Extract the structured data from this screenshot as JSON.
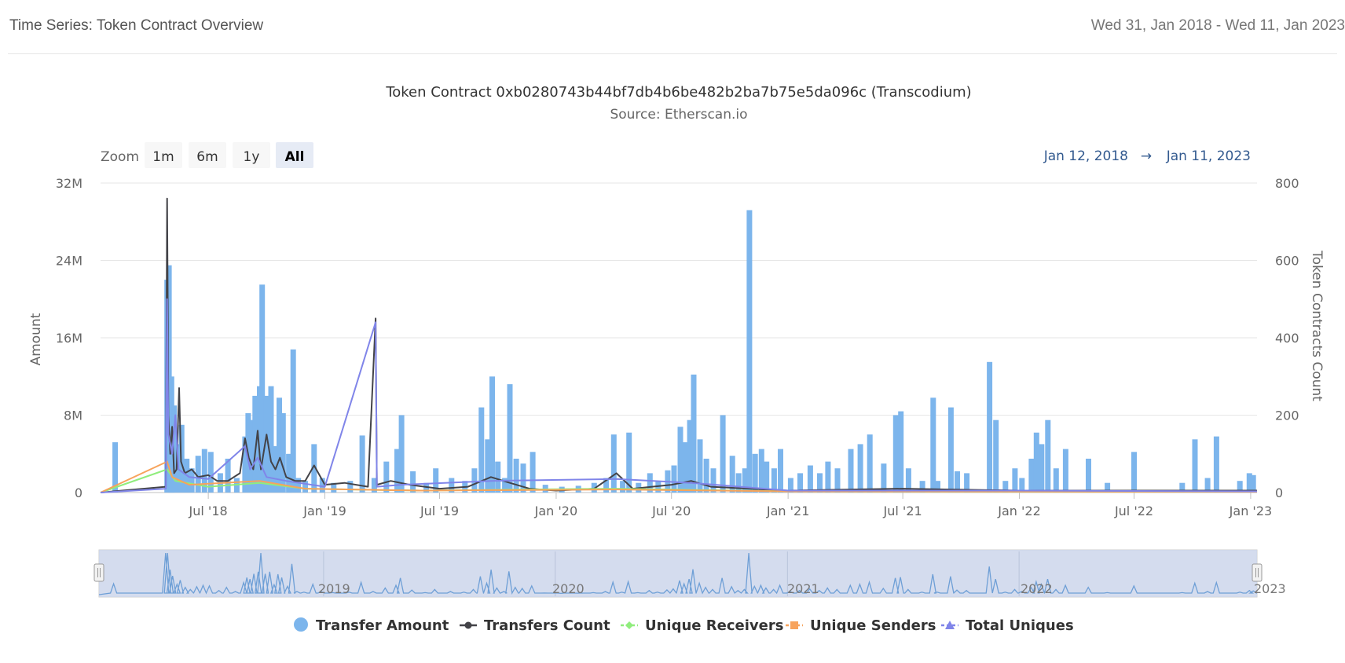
{
  "header": {
    "title": "Time Series: Token Contract Overview",
    "date_range": "Wed 31, Jan 2018 - Wed 11, Jan 2023"
  },
  "chart": {
    "title": "Token Contract 0xb0280743b44bf7db4b6be482b2ba7b75e5da096c (Transcodium)",
    "subtitle": "Source: Etherscan.io",
    "zoom": {
      "label": "Zoom",
      "buttons": [
        {
          "label": "1m",
          "active": false
        },
        {
          "label": "6m",
          "active": false
        },
        {
          "label": "1y",
          "active": false
        },
        {
          "label": "All",
          "active": true
        }
      ]
    },
    "range_from": "Jan 12, 2018",
    "range_arrow": "→",
    "range_to": "Jan 11, 2023",
    "navigator_years": [
      "2019",
      "2020",
      "2021",
      "2022",
      "2023"
    ]
  },
  "chart_data": {
    "type": "bar",
    "x_start": "2018-01-12",
    "x_end": "2023-01-11",
    "y_left": {
      "label": "Amount",
      "min": 0,
      "max": 32000000,
      "ticks": [
        "0",
        "8M",
        "16M",
        "24M",
        "32M"
      ]
    },
    "y_right": {
      "label": "Token Contracts Count",
      "min": 0,
      "max": 800,
      "ticks": [
        "0",
        "200",
        "400",
        "600",
        "800"
      ]
    },
    "x_ticks": [
      {
        "label": "Jul '18",
        "date": "2018-07-01"
      },
      {
        "label": "Jan '19",
        "date": "2019-01-01"
      },
      {
        "label": "Jul '19",
        "date": "2019-07-01"
      },
      {
        "label": "Jan '20",
        "date": "2020-01-01"
      },
      {
        "label": "Jul '20",
        "date": "2020-07-01"
      },
      {
        "label": "Jan '21",
        "date": "2021-01-01"
      },
      {
        "label": "Jul '21",
        "date": "2021-07-01"
      },
      {
        "label": "Jan '22",
        "date": "2022-01-01"
      },
      {
        "label": "Jul '22",
        "date": "2022-07-01"
      },
      {
        "label": "Jan '23",
        "date": "2023-01-01"
      }
    ],
    "grid": true,
    "legend_position": "bottom",
    "series": [
      {
        "name": "Transfer Amount",
        "type": "column",
        "axis": "left",
        "color": "#7cb5ec",
        "points": [
          [
            "2018-02-04",
            5200000
          ],
          [
            "2018-04-27",
            22000000
          ],
          [
            "2018-04-30",
            23500000
          ],
          [
            "2018-05-04",
            12000000
          ],
          [
            "2018-05-08",
            9000000
          ],
          [
            "2018-05-15",
            5000000
          ],
          [
            "2018-05-20",
            7000000
          ],
          [
            "2018-05-28",
            3500000
          ],
          [
            "2018-06-05",
            2500000
          ],
          [
            "2018-06-15",
            3800000
          ],
          [
            "2018-06-25",
            4500000
          ],
          [
            "2018-07-05",
            4200000
          ],
          [
            "2018-07-20",
            2000000
          ],
          [
            "2018-08-01",
            3500000
          ],
          [
            "2018-08-15",
            1500000
          ],
          [
            "2018-08-28",
            5800000
          ],
          [
            "2018-09-02",
            8200000
          ],
          [
            "2018-09-07",
            7500000
          ],
          [
            "2018-09-13",
            10000000
          ],
          [
            "2018-09-20",
            11000000
          ],
          [
            "2018-09-24",
            21500000
          ],
          [
            "2018-10-01",
            10000000
          ],
          [
            "2018-10-08",
            11000000
          ],
          [
            "2018-10-15",
            4800000
          ],
          [
            "2018-10-21",
            9800000
          ],
          [
            "2018-10-27",
            8200000
          ],
          [
            "2018-11-05",
            4000000
          ],
          [
            "2018-11-12",
            14800000
          ],
          [
            "2018-11-20",
            1500000
          ],
          [
            "2018-12-01",
            1200000
          ],
          [
            "2018-12-15",
            5000000
          ],
          [
            "2018-12-28",
            1500000
          ],
          [
            "2019-01-15",
            1000000
          ],
          [
            "2019-02-10",
            1200000
          ],
          [
            "2019-03-01",
            5900000
          ],
          [
            "2019-03-20",
            1500000
          ],
          [
            "2019-04-08",
            3200000
          ],
          [
            "2019-04-25",
            4500000
          ],
          [
            "2019-05-02",
            8000000
          ],
          [
            "2019-05-20",
            2200000
          ],
          [
            "2019-06-10",
            1000000
          ],
          [
            "2019-06-25",
            2500000
          ],
          [
            "2019-07-20",
            1500000
          ],
          [
            "2019-08-10",
            1200000
          ],
          [
            "2019-08-25",
            2500000
          ],
          [
            "2019-09-05",
            8800000
          ],
          [
            "2019-09-15",
            5500000
          ],
          [
            "2019-09-22",
            12000000
          ],
          [
            "2019-10-01",
            3200000
          ],
          [
            "2019-10-12",
            1500000
          ],
          [
            "2019-10-20",
            11200000
          ],
          [
            "2019-10-30",
            3500000
          ],
          [
            "2019-11-10",
            3000000
          ],
          [
            "2019-11-25",
            4200000
          ],
          [
            "2019-12-15",
            800000
          ],
          [
            "2020-01-10",
            600000
          ],
          [
            "2020-02-05",
            700000
          ],
          [
            "2020-03-01",
            1000000
          ],
          [
            "2020-03-20",
            1500000
          ],
          [
            "2020-04-01",
            6000000
          ],
          [
            "2020-04-15",
            1200000
          ],
          [
            "2020-04-25",
            6200000
          ],
          [
            "2020-05-10",
            1000000
          ],
          [
            "2020-05-28",
            2000000
          ],
          [
            "2020-06-10",
            1200000
          ],
          [
            "2020-06-25",
            2300000
          ],
          [
            "2020-07-05",
            2800000
          ],
          [
            "2020-07-15",
            6800000
          ],
          [
            "2020-07-22",
            5200000
          ],
          [
            "2020-07-30",
            7500000
          ],
          [
            "2020-08-05",
            12200000
          ],
          [
            "2020-08-15",
            5500000
          ],
          [
            "2020-08-25",
            3500000
          ],
          [
            "2020-09-05",
            2500000
          ],
          [
            "2020-09-20",
            8000000
          ],
          [
            "2020-10-05",
            3800000
          ],
          [
            "2020-10-15",
            2000000
          ],
          [
            "2020-10-25",
            2500000
          ],
          [
            "2020-11-01",
            29200000
          ],
          [
            "2020-11-10",
            4000000
          ],
          [
            "2020-11-20",
            4500000
          ],
          [
            "2020-11-28",
            3200000
          ],
          [
            "2020-12-10",
            2500000
          ],
          [
            "2020-12-20",
            4500000
          ],
          [
            "2021-01-05",
            1500000
          ],
          [
            "2021-01-20",
            2000000
          ],
          [
            "2021-02-05",
            2800000
          ],
          [
            "2021-02-20",
            2000000
          ],
          [
            "2021-03-05",
            3200000
          ],
          [
            "2021-03-20",
            2500000
          ],
          [
            "2021-04-10",
            4500000
          ],
          [
            "2021-04-25",
            5000000
          ],
          [
            "2021-05-10",
            6000000
          ],
          [
            "2021-06-01",
            3000000
          ],
          [
            "2021-06-20",
            8000000
          ],
          [
            "2021-06-28",
            8400000
          ],
          [
            "2021-07-10",
            2500000
          ],
          [
            "2021-08-01",
            1200000
          ],
          [
            "2021-08-18",
            9800000
          ],
          [
            "2021-08-25",
            1200000
          ],
          [
            "2021-09-15",
            8800000
          ],
          [
            "2021-09-25",
            2200000
          ],
          [
            "2021-10-10",
            2000000
          ],
          [
            "2021-11-15",
            13500000
          ],
          [
            "2021-11-25",
            7500000
          ],
          [
            "2021-12-10",
            1200000
          ],
          [
            "2021-12-25",
            2500000
          ],
          [
            "2022-01-05",
            1500000
          ],
          [
            "2022-01-20",
            3500000
          ],
          [
            "2022-01-28",
            6200000
          ],
          [
            "2022-02-05",
            5000000
          ],
          [
            "2022-02-15",
            7500000
          ],
          [
            "2022-02-28",
            2500000
          ],
          [
            "2022-03-15",
            4500000
          ],
          [
            "2022-04-20",
            3500000
          ],
          [
            "2022-05-20",
            1000000
          ],
          [
            "2022-07-01",
            4200000
          ],
          [
            "2022-09-15",
            1000000
          ],
          [
            "2022-10-05",
            5500000
          ],
          [
            "2022-10-25",
            1500000
          ],
          [
            "2022-11-08",
            5800000
          ],
          [
            "2022-12-15",
            1200000
          ],
          [
            "2022-12-30",
            2000000
          ],
          [
            "2023-01-05",
            1800000
          ]
        ]
      },
      {
        "name": "Transfers Count",
        "type": "line",
        "axis": "right",
        "color": "#434348",
        "points": [
          [
            "2018-01-12",
            0
          ],
          [
            "2018-02-15",
            5
          ],
          [
            "2018-04-25",
            15
          ],
          [
            "2018-04-27",
            760
          ],
          [
            "2018-04-28",
            500
          ],
          [
            "2018-04-29",
            200
          ],
          [
            "2018-05-02",
            100
          ],
          [
            "2018-05-05",
            170
          ],
          [
            "2018-05-08",
            50
          ],
          [
            "2018-05-12",
            60
          ],
          [
            "2018-05-16",
            270
          ],
          [
            "2018-05-19",
            80
          ],
          [
            "2018-05-25",
            50
          ],
          [
            "2018-06-05",
            60
          ],
          [
            "2018-06-15",
            40
          ],
          [
            "2018-07-01",
            45
          ],
          [
            "2018-07-15",
            30
          ],
          [
            "2018-08-01",
            30
          ],
          [
            "2018-08-20",
            50
          ],
          [
            "2018-08-28",
            140
          ],
          [
            "2018-09-03",
            90
          ],
          [
            "2018-09-10",
            60
          ],
          [
            "2018-09-17",
            160
          ],
          [
            "2018-09-22",
            60
          ],
          [
            "2018-10-01",
            150
          ],
          [
            "2018-10-08",
            80
          ],
          [
            "2018-10-15",
            60
          ],
          [
            "2018-10-22",
            90
          ],
          [
            "2018-11-01",
            40
          ],
          [
            "2018-11-15",
            30
          ],
          [
            "2018-12-01",
            30
          ],
          [
            "2018-12-15",
            70
          ],
          [
            "2019-01-01",
            20
          ],
          [
            "2019-02-01",
            25
          ],
          [
            "2019-03-10",
            15
          ],
          [
            "2019-03-22",
            450
          ],
          [
            "2019-03-24",
            20
          ],
          [
            "2019-04-15",
            30
          ],
          [
            "2019-05-15",
            20
          ],
          [
            "2019-07-01",
            10
          ],
          [
            "2019-08-15",
            15
          ],
          [
            "2019-09-20",
            40
          ],
          [
            "2019-10-20",
            25
          ],
          [
            "2019-11-20",
            10
          ],
          [
            "2020-01-01",
            5
          ],
          [
            "2020-03-01",
            10
          ],
          [
            "2020-04-05",
            50
          ],
          [
            "2020-05-01",
            10
          ],
          [
            "2020-07-01",
            20
          ],
          [
            "2020-08-01",
            30
          ],
          [
            "2020-09-01",
            15
          ],
          [
            "2020-11-01",
            10
          ],
          [
            "2021-01-01",
            5
          ],
          [
            "2021-07-01",
            10
          ],
          [
            "2022-01-01",
            5
          ],
          [
            "2022-07-01",
            5
          ],
          [
            "2023-01-11",
            5
          ]
        ]
      },
      {
        "name": "Unique Receivers",
        "type": "line",
        "axis": "right",
        "color": "#90ed7d",
        "points": [
          [
            "2018-01-12",
            0
          ],
          [
            "2018-04-27",
            60
          ],
          [
            "2018-05-10",
            30
          ],
          [
            "2018-07-01",
            15
          ],
          [
            "2018-09-20",
            25
          ],
          [
            "2018-12-01",
            10
          ],
          [
            "2019-06-01",
            5
          ],
          [
            "2020-04-05",
            10
          ],
          [
            "2021-01-01",
            3
          ],
          [
            "2023-01-11",
            2
          ]
        ]
      },
      {
        "name": "Unique Senders",
        "type": "line",
        "axis": "right",
        "color": "#f7a35c",
        "points": [
          [
            "2018-01-12",
            0
          ],
          [
            "2018-04-27",
            80
          ],
          [
            "2018-05-05",
            40
          ],
          [
            "2018-06-01",
            20
          ],
          [
            "2018-09-20",
            30
          ],
          [
            "2018-12-01",
            10
          ],
          [
            "2019-06-01",
            5
          ],
          [
            "2020-04-05",
            8
          ],
          [
            "2021-01-01",
            3
          ],
          [
            "2023-01-11",
            2
          ]
        ]
      },
      {
        "name": "Total Uniques",
        "type": "line",
        "axis": "right",
        "color": "#8085e9",
        "points": [
          [
            "2018-01-12",
            0
          ],
          [
            "2018-04-25",
            10
          ],
          [
            "2018-04-27",
            500
          ],
          [
            "2018-04-29",
            150
          ],
          [
            "2018-05-05",
            100
          ],
          [
            "2018-05-10",
            200
          ],
          [
            "2018-05-15",
            60
          ],
          [
            "2018-06-01",
            40
          ],
          [
            "2018-07-01",
            35
          ],
          [
            "2018-08-28",
            120
          ],
          [
            "2018-09-05",
            60
          ],
          [
            "2018-09-17",
            90
          ],
          [
            "2018-10-01",
            40
          ],
          [
            "2018-11-01",
            30
          ],
          [
            "2019-01-01",
            15
          ],
          [
            "2019-03-22",
            440
          ],
          [
            "2019-03-24",
            15
          ],
          [
            "2019-05-01",
            20
          ],
          [
            "2019-09-20",
            30
          ],
          [
            "2020-04-05",
            35
          ],
          [
            "2020-08-01",
            25
          ],
          [
            "2021-01-01",
            5
          ],
          [
            "2022-01-01",
            5
          ],
          [
            "2023-01-11",
            3
          ]
        ]
      }
    ]
  },
  "legend": {
    "items": [
      {
        "label": "Transfer Amount",
        "color": "#7cb5ec",
        "marker": "circle"
      },
      {
        "label": "Transfers Count",
        "color": "#434348",
        "marker": "circle-line"
      },
      {
        "label": "Unique Receivers",
        "color": "#90ed7d",
        "marker": "diamond-line"
      },
      {
        "label": "Unique Senders",
        "color": "#f7a35c",
        "marker": "square-line"
      },
      {
        "label": "Total Uniques",
        "color": "#8085e9",
        "marker": "triangle-line"
      }
    ]
  }
}
